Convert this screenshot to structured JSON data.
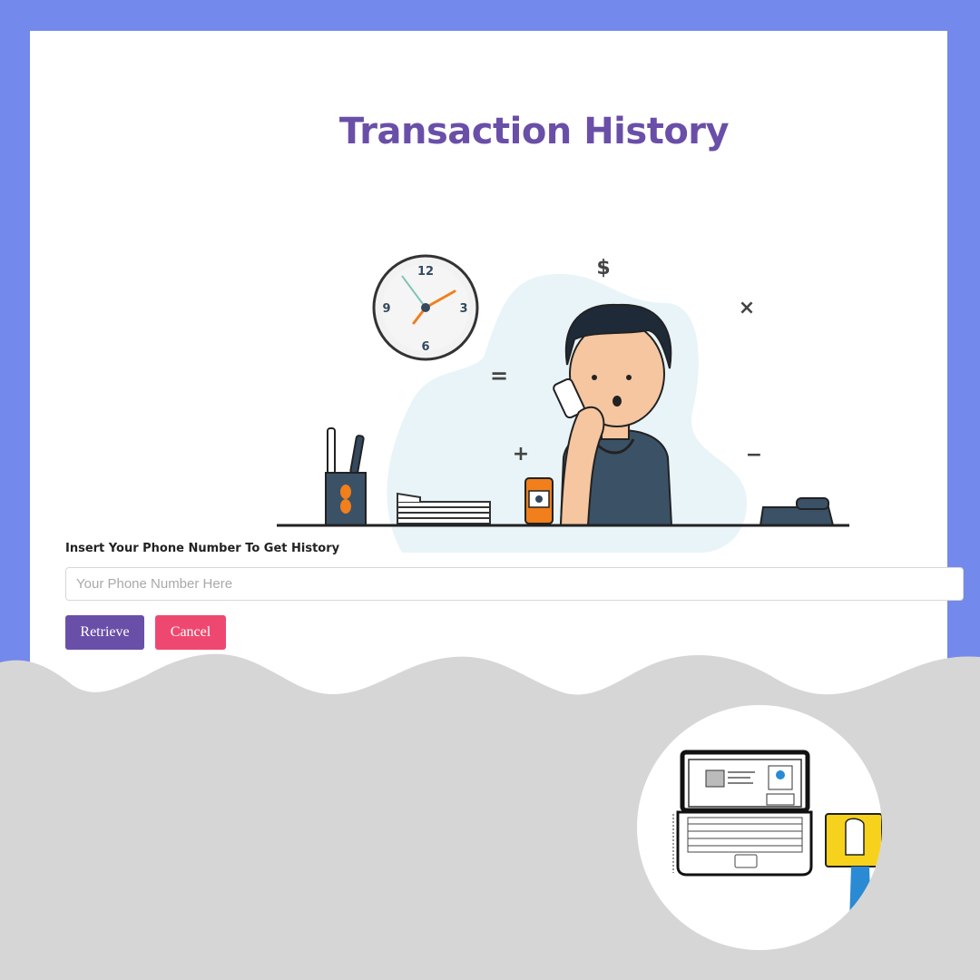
{
  "header": {
    "title": "Transaction History"
  },
  "illustration": {
    "clock_numbers": [
      "12",
      "3",
      "6",
      "9"
    ],
    "math_symbols": [
      "$",
      "×",
      "=",
      "+",
      "−"
    ]
  },
  "form": {
    "label": "Insert Your Phone Number To Get History",
    "phone_placeholder": "Your Phone Number Here",
    "phone_value": "",
    "retrieve_label": "Retrieve",
    "cancel_label": "Cancel"
  },
  "colors": {
    "background": "#7489ec",
    "title": "#6a4fa8",
    "retrieve_button": "#6a4fa8",
    "cancel_button": "#ef4870",
    "bottom_panel": "#d6d6d6"
  }
}
